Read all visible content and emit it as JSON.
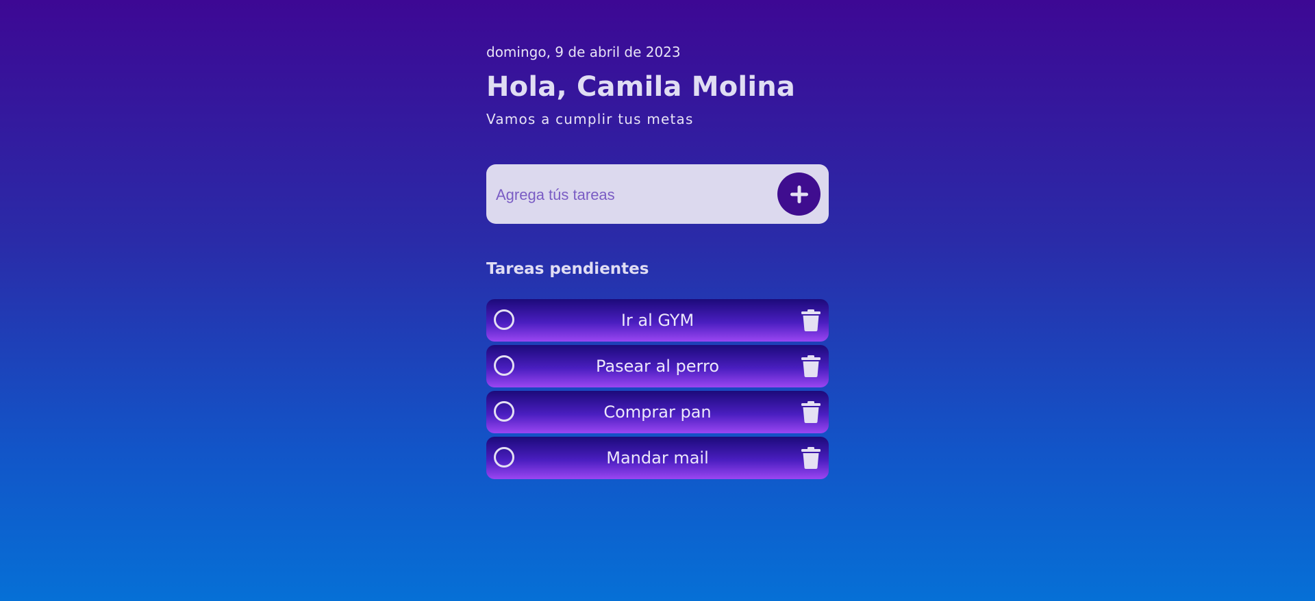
{
  "header": {
    "date": "domingo, 9 de abril de 2023",
    "greeting": "Hola, Camila Molina",
    "subtitle": "Vamos a cumplir tus metas"
  },
  "add_task": {
    "placeholder": "Agrega tús tareas",
    "value": "",
    "button_icon": "plus-icon"
  },
  "pending": {
    "title": "Tareas pendientes",
    "tasks": [
      {
        "label": "Ir al GYM",
        "done": false
      },
      {
        "label": "Pasear al perro",
        "done": false
      },
      {
        "label": "Comprar pan",
        "done": false
      },
      {
        "label": "Mandar mail",
        "done": false
      }
    ]
  },
  "icons": {
    "check": "circle-check-icon",
    "delete": "trash-icon"
  },
  "colors": {
    "accent": "#3f0d8f",
    "input_bg": "#dcd9ee",
    "text_light": "#e4e0f3"
  }
}
